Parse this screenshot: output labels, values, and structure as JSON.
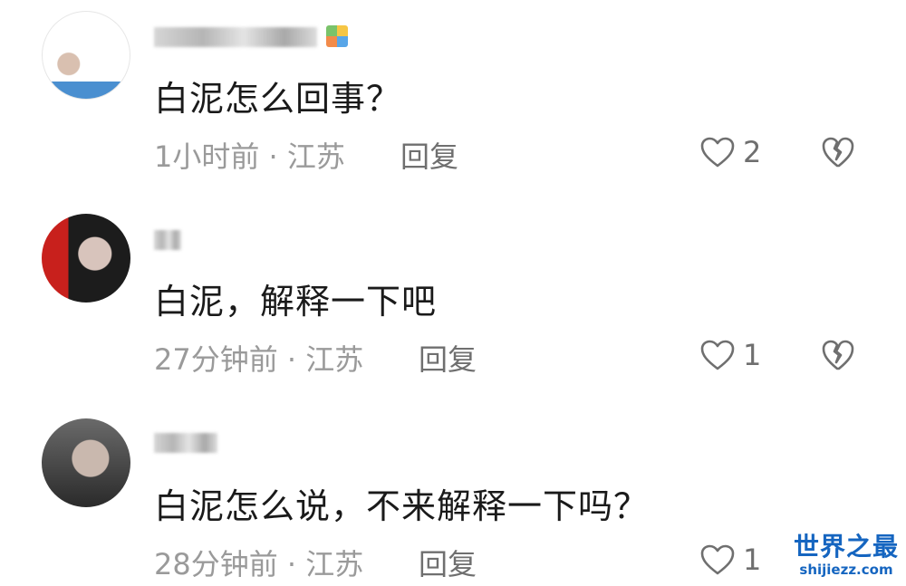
{
  "comments": [
    {
      "text": "白泥怎么回事？",
      "time": "1小时前 · 江苏",
      "reply": "回复",
      "likes": "2"
    },
    {
      "text": "白泥，解释一下吧",
      "time": "27分钟前 · 江苏",
      "reply": "回复",
      "likes": "1"
    },
    {
      "text": "白泥怎么说，不来解释一下吗？",
      "time": "28分钟前 · 江苏",
      "reply": "回复",
      "likes": "1"
    }
  ],
  "watermark": {
    "title": "世界之最",
    "url": "shijiezz.com"
  },
  "icons": {
    "like": "heart-outline-icon",
    "dislike": "broken-heart-icon"
  },
  "colors": {
    "text": "#1a1a1a",
    "meta": "#9a9a9a",
    "icon": "#6f6f6f",
    "watermark": "#1565c0"
  }
}
